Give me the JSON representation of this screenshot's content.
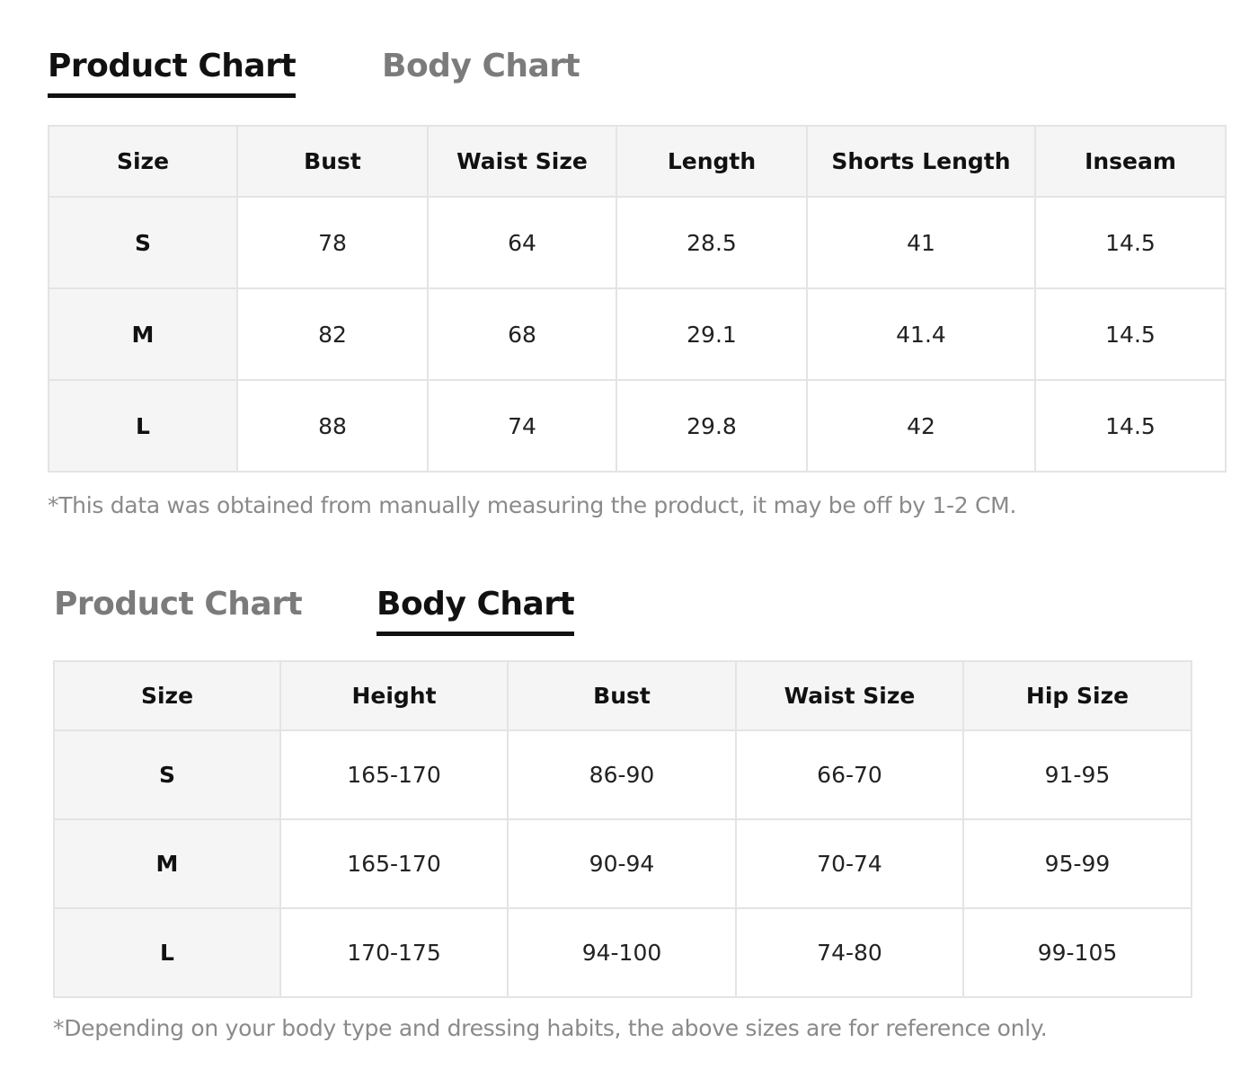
{
  "product_section": {
    "tabs": [
      {
        "label": "Product Chart",
        "active": true
      },
      {
        "label": "Body Chart",
        "active": false
      }
    ],
    "table": {
      "headers": [
        "Size",
        "Bust",
        "Waist Size",
        "Length",
        "Shorts Length",
        "Inseam"
      ],
      "rows": [
        [
          "S",
          "78",
          "64",
          "28.5",
          "41",
          "14.5"
        ],
        [
          "M",
          "82",
          "68",
          "29.1",
          "41.4",
          "14.5"
        ],
        [
          "L",
          "88",
          "74",
          "29.8",
          "42",
          "14.5"
        ]
      ]
    },
    "note": "*This data was obtained from manually measuring the product, it may be off by 1-2 CM."
  },
  "body_section": {
    "tabs": [
      {
        "label": "Product Chart",
        "active": false
      },
      {
        "label": "Body Chart",
        "active": true
      }
    ],
    "table": {
      "headers": [
        "Size",
        "Height",
        "Bust",
        "Waist Size",
        "Hip Size"
      ],
      "rows": [
        [
          "S",
          "165-170",
          "86-90",
          "66-70",
          "91-95"
        ],
        [
          "M",
          "165-170",
          "90-94",
          "70-74",
          "95-99"
        ],
        [
          "L",
          "170-175",
          "94-100",
          "74-80",
          "99-105"
        ]
      ]
    },
    "note": "*Depending on your body type and dressing habits, the above sizes are for reference only."
  },
  "colors": {
    "active_tab": "#111111",
    "inactive_tab": "#7b7b7b",
    "header_bg": "#f5f5f5",
    "border": "#e4e4e4",
    "note": "#8a8a8a"
  }
}
